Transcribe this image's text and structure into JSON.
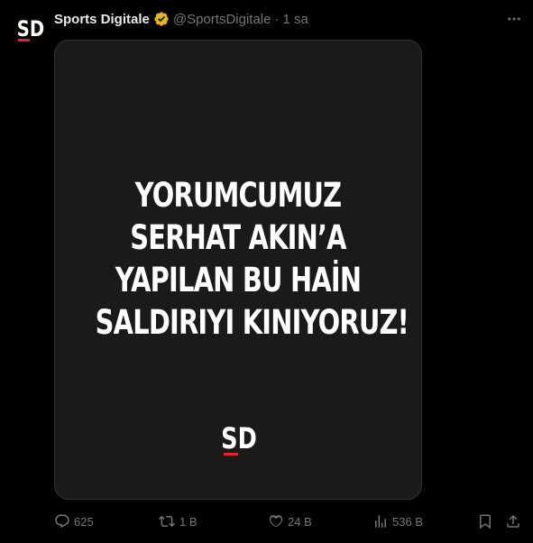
{
  "author": {
    "name": "Sports Digitale",
    "handle": "@SportsDigitale",
    "separator": "·",
    "time": "1 sa",
    "avatar_text": "SD"
  },
  "media": {
    "headline_lines": [
      "YORUMCUMUZ",
      "SERHAT AKIN’A",
      "YAPILAN BU HAİN",
      "SALDIRIYI KINIYORUZ!"
    ],
    "logo_text": "SD",
    "background_color": "#1a1a1a"
  },
  "actions": {
    "replies": "625",
    "reposts": "1 B",
    "likes": "24 B",
    "views": "536 B"
  },
  "colors": {
    "background": "#000000",
    "text_primary": "#e7e9ea",
    "text_secondary": "#71767b",
    "verified_badge": "#e2b719",
    "logo_accent": "#e0252b"
  },
  "icons": {
    "verified": "verified-badge-icon",
    "more": "more-dots-icon",
    "reply": "reply-icon",
    "repost": "repost-icon",
    "like": "heart-icon",
    "views": "views-icon",
    "bookmark": "bookmark-icon",
    "share": "share-icon"
  }
}
